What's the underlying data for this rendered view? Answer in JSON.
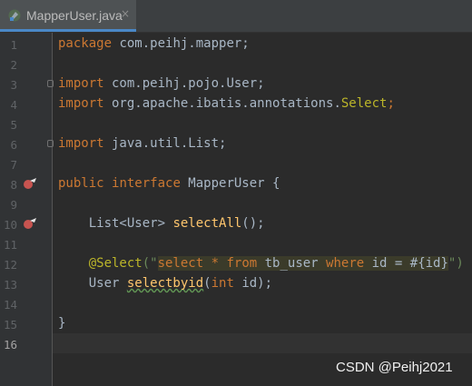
{
  "tab": {
    "title": "MapperUser.java",
    "close_glyph": "×",
    "icon": "java-interface-icon"
  },
  "gutter": {
    "line_numbers": [
      "1",
      "2",
      "3",
      "4",
      "5",
      "6",
      "7",
      "8",
      "9",
      "10",
      "11",
      "12",
      "13",
      "14",
      "15",
      "16"
    ],
    "current_line": "16",
    "markers": [
      "implementation-marker-icon (line 8)",
      "implementation-marker-icon (line 10)"
    ]
  },
  "code": {
    "l1": {
      "kw": "package",
      "rest": " com.peihj.mapper;"
    },
    "l3": {
      "kw": "import",
      "rest": " com.peihj.pojo.User;"
    },
    "l4": {
      "kw": "import",
      "pkg": " org.apache.ibatis.annotations.",
      "cls": "Select",
      "semi": ";"
    },
    "l6": {
      "kw": "import",
      "rest": " java.util.List;"
    },
    "l8": {
      "kw1": "public",
      "kw2": "interface",
      "rest": " MapperUser {"
    },
    "l10": {
      "type": "    List<User> ",
      "fn": "selectAll",
      "rest": "();"
    },
    "l12": {
      "annot": "    @Select",
      "open": "(\"",
      "sql1": "select ",
      "star": "*",
      "sql2": " from ",
      "tbl": "tb_user ",
      "sql3": "where",
      "tail": " id = #{id}",
      "close": "\")"
    },
    "l13": {
      "type": "    User ",
      "fn": "selectbyid",
      "open": "(",
      "kw": "int",
      "rest": " id);"
    },
    "l15": {
      "rest": "}"
    }
  },
  "colors": {
    "background": "#2b2b2b",
    "keyword": "#cc7832",
    "annotation": "#bbb529",
    "string": "#6a8759",
    "method": "#ffc66d",
    "text": "#a9b7c6"
  },
  "watermark": "CSDN @Peihj2021"
}
